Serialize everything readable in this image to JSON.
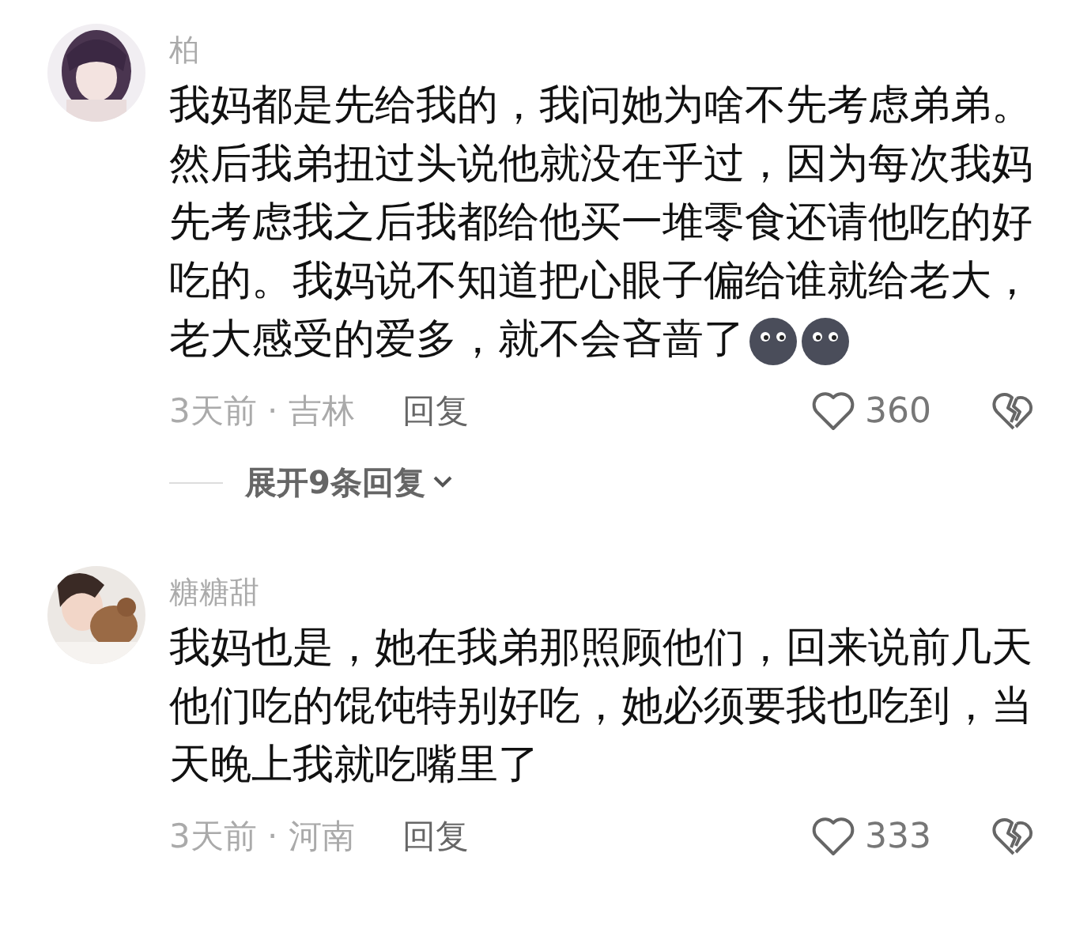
{
  "comments": [
    {
      "username": "柏",
      "avatar": {
        "kind": "picture"
      },
      "lines": [
        "我妈都是先给我的，我问她为啥不先考虑弟弟。",
        "然后我弟扭过头说他就没在乎过，因为每次我妈",
        "先考虑我之后我都给他买一堆零食还请他吃的好",
        "吃的。我妈说不知道把心眼子偏给谁就给老大，",
        "老大感受的爱多，就不会吝啬了"
      ],
      "emojis": [
        {
          "kind": "dark-face"
        },
        {
          "kind": "dark-face"
        }
      ],
      "meta": "3天前 · 吉林",
      "reply": "回复",
      "likes": "360",
      "expand": "展开9条回复"
    },
    {
      "username": "糖糖甜",
      "avatar": {
        "kind": "picture"
      },
      "lines": [
        "我妈也是，她在我弟那照顾他们，回来说前几天",
        "他们吃的馄饨特别好吃，她必须要我也吃到，当",
        "天晚上我就吃嘴里了"
      ],
      "meta": "3天前 · 河南",
      "reply": "回复",
      "likes": "333"
    }
  ]
}
